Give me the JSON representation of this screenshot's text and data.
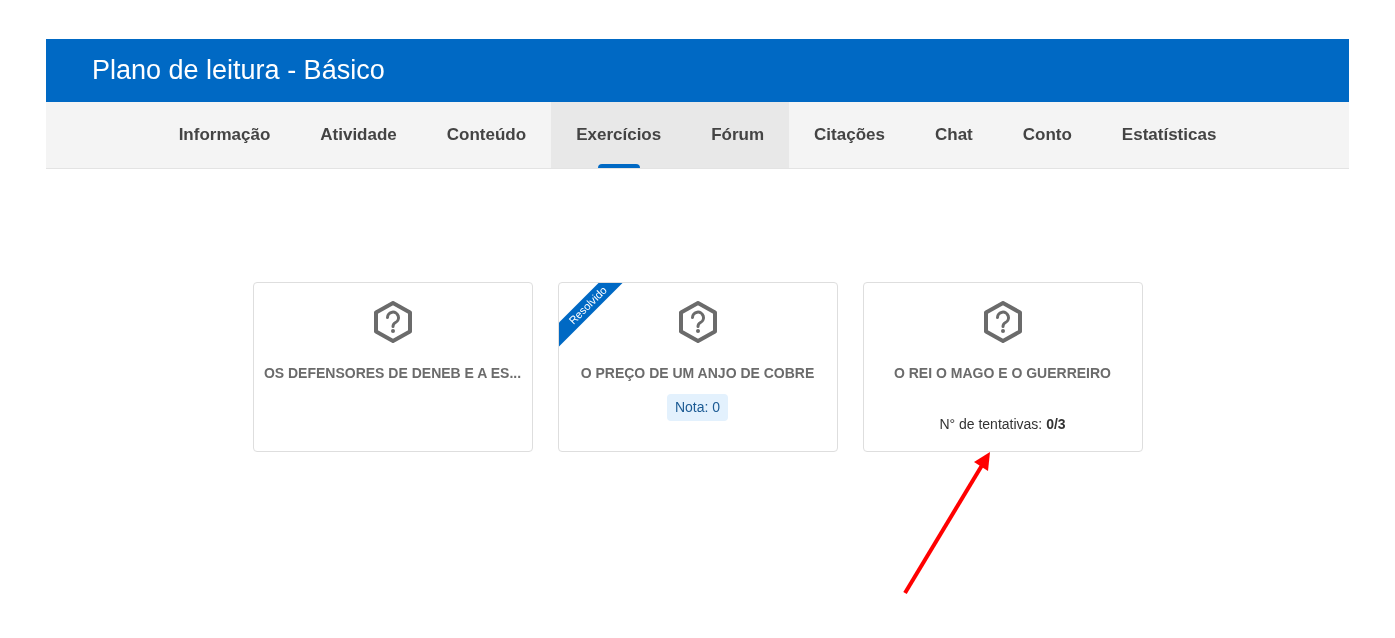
{
  "header": {
    "title": "Plano de leitura - Básico"
  },
  "tabs": [
    {
      "label": "Informação",
      "selected": false,
      "highlighted": false
    },
    {
      "label": "Atividade",
      "selected": false,
      "highlighted": false
    },
    {
      "label": "Conteúdo",
      "selected": false,
      "highlighted": false
    },
    {
      "label": "Exercícios",
      "selected": true,
      "highlighted": true
    },
    {
      "label": "Fórum",
      "selected": false,
      "highlighted": true
    },
    {
      "label": "Citações",
      "selected": false,
      "highlighted": false
    },
    {
      "label": "Chat",
      "selected": false,
      "highlighted": false
    },
    {
      "label": "Conto",
      "selected": false,
      "highlighted": false
    },
    {
      "label": "Estatísticas",
      "selected": false,
      "highlighted": false
    }
  ],
  "exercises": [
    {
      "title": "OS DEFENSORES DE DENEB E A ES..."
    },
    {
      "title": "O PREÇO DE UM ANJO DE COBRE",
      "ribbon": "Resolvido",
      "grade": "Nota: 0"
    },
    {
      "title": "O REI O MAGO E O GUERREIRO",
      "attempts": "N° de tentativas: **0/3**"
    }
  ]
}
